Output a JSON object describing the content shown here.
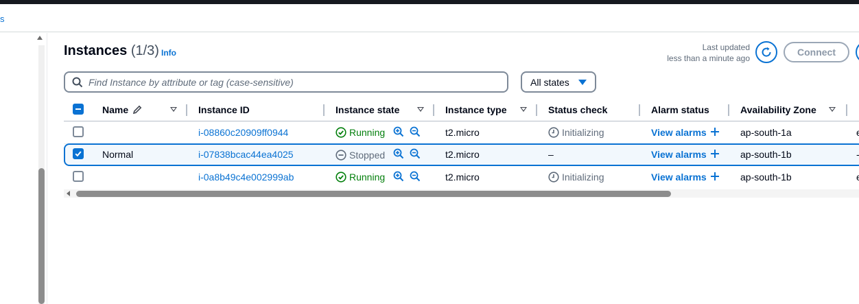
{
  "breadcrumb": {
    "fragment": "s"
  },
  "header": {
    "title": "Instances",
    "count": "(1/3)",
    "info_label": "Info",
    "last_updated_line1": "Last updated",
    "last_updated_line2": "less than a minute ago",
    "connect_label": "Connect"
  },
  "filter": {
    "search_placeholder": "Find Instance by attribute or tag (case-sensitive)",
    "states_label": "All states"
  },
  "table": {
    "columns": [
      "Name",
      "Instance ID",
      "Instance state",
      "Instance type",
      "Status check",
      "Alarm status",
      "Availability Zone"
    ],
    "rows": [
      {
        "selected": false,
        "name": "",
        "instance_id": "i-08860c20909ff0944",
        "state": "Running",
        "type": "t2.micro",
        "status_check": "Initializing",
        "alarm": "View alarms",
        "az": "ap-south-1a",
        "edge": "e"
      },
      {
        "selected": true,
        "name": "Normal",
        "instance_id": "i-07838bcac44ea4025",
        "state": "Stopped",
        "type": "t2.micro",
        "status_check": "–",
        "alarm": "View alarms",
        "az": "ap-south-1b",
        "edge": "-"
      },
      {
        "selected": false,
        "name": "",
        "instance_id": "i-0a8b49c4e002999ab",
        "state": "Running",
        "type": "t2.micro",
        "status_check": "Initializing",
        "alarm": "View alarms",
        "az": "ap-south-1b",
        "edge": "e"
      }
    ]
  },
  "colors": {
    "accent": "#0972d3",
    "running": "#037f0c",
    "stopped": "#5f6b7a"
  }
}
